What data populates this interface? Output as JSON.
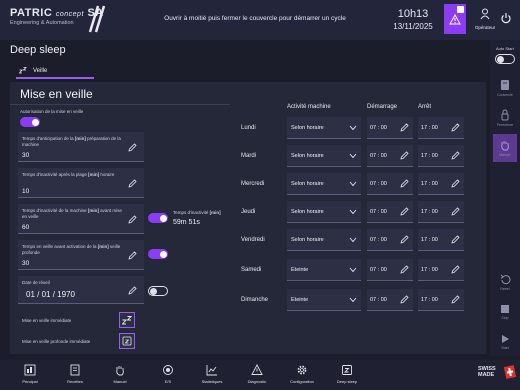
{
  "header": {
    "logo_main": "PATRIC",
    "logo_small": "concept",
    "logo_sa": "SA",
    "logo_sub": "Engineering & Automation",
    "message": "Ouvrir à moitié puis fermer le couvercle pour démarrer un cycle",
    "time": "10h13",
    "date": "13/11/2025",
    "user_label": "Opérateur"
  },
  "page": {
    "title": "Deep sleep",
    "tab_label": "Veille"
  },
  "section": {
    "title": "Mise en veille",
    "auth_label": "Autorisation de la mise en veille",
    "anticipation": {
      "label_pre": "Temps d'anticipation de la ",
      "unit": "[min]",
      "label_post": " préparation de la machine",
      "value": "30"
    },
    "inactivity_after": {
      "label_pre": "Temps d'inactivité après la plage ",
      "unit": "[min]",
      "label_post": " horaire",
      "value": "10"
    },
    "inactivity_machine": {
      "label_pre": "Temps d'inactivité de la machine ",
      "unit": "[min]",
      "label_post": " avant mise en veille",
      "value": "60",
      "side_label_pre": "Temps d'inactivité ",
      "side_unit": "[min]",
      "side_value": "59m 51s"
    },
    "deep_sleep_wait": {
      "label_pre": "Temps en veille avant activation de la ",
      "unit": "[min]",
      "label_post": " veille profonde",
      "value": "30"
    },
    "wake_date": {
      "label": "Date de réveil",
      "value": "01 / 01 / 1970"
    },
    "immediate_sleep_label": "Mise en veille immédiate",
    "immediate_deep_sleep_label": "Mise en veille profonde immédiate"
  },
  "schedule": {
    "col_activity": "Activité machine",
    "col_start": "Démarrage",
    "col_stop": "Arrêt",
    "rows": [
      {
        "day": "Lundi",
        "activity": "Selon horaire",
        "start": "07 : 00",
        "stop": "17 : 00"
      },
      {
        "day": "Mardi",
        "activity": "Selon horaire",
        "start": "07 : 00",
        "stop": "17 : 00"
      },
      {
        "day": "Mercredi",
        "activity": "Selon horaire",
        "start": "07 : 00",
        "stop": "17 : 00"
      },
      {
        "day": "Jeudi",
        "activity": "Selon horaire",
        "start": "07 : 00",
        "stop": "17 : 00"
      },
      {
        "day": "Vendredi",
        "activity": "Selon horaire",
        "start": "07 : 00",
        "stop": "17 : 00"
      },
      {
        "day": "Samedi",
        "activity": "Eteinte",
        "start": "07 : 00",
        "stop": "17 : 00"
      },
      {
        "day": "Dimanche",
        "activity": "Eteinte",
        "start": "07 : 00",
        "stop": "17 : 00"
      }
    ]
  },
  "sidebar": {
    "auto_start_label": "Auto Start",
    "couvercle_label": "Couvercle",
    "fermeture_label": "Fermeture",
    "manuel_label": "Manuel",
    "reset_label": "Reset",
    "stop_label": "Stop",
    "start_label": "Start"
  },
  "nav": {
    "items": [
      "Principal",
      "Recettes",
      "Manuel",
      "E/S",
      "Statistiques",
      "Diagnostic",
      "Configuration",
      "Deep sleep"
    ]
  },
  "footer": {
    "swiss_line1": "SWISS",
    "swiss_line2": "MADE"
  },
  "colors": {
    "accent": "#8a3df5",
    "background": "#1b1d2b",
    "panel": "#252839"
  }
}
